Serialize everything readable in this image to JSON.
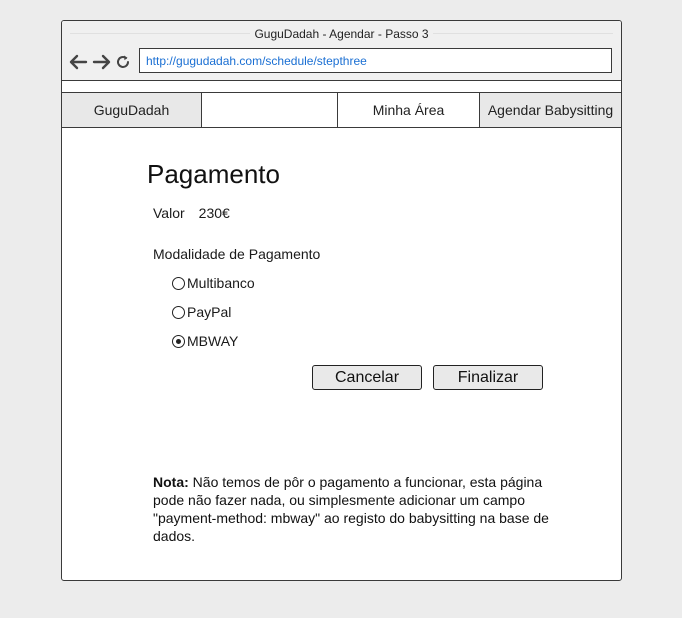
{
  "window": {
    "title": "GuguDadah - Agendar - Passo 3",
    "url": "http://gugudadah.com/schedule/stepthree"
  },
  "icons": {
    "back": "arrow-left-icon",
    "forward": "arrow-right-icon",
    "reload": "reload-icon"
  },
  "menu": {
    "brand": "GuguDadah",
    "blank": "",
    "minha_area": "Minha Área",
    "agendar": "Agendar Babysitting"
  },
  "payment": {
    "heading": "Pagamento",
    "valor_label": "Valor",
    "valor_value": "230€",
    "modalidade_label": "Modalidade de Pagamento",
    "options": [
      {
        "label": "Multibanco",
        "checked": false
      },
      {
        "label": "PayPal",
        "checked": false
      },
      {
        "label": "MBWAY",
        "checked": true
      }
    ],
    "cancel_label": "Cancelar",
    "finalize_label": "Finalizar"
  },
  "note": {
    "bold": "Nota:",
    "text": " Não temos de pôr o pagamento a funcionar, esta página pode não fazer nada, ou simplesmente adicionar um campo \"payment-method: mbway\" ao registo do babysitting na base de dados."
  }
}
